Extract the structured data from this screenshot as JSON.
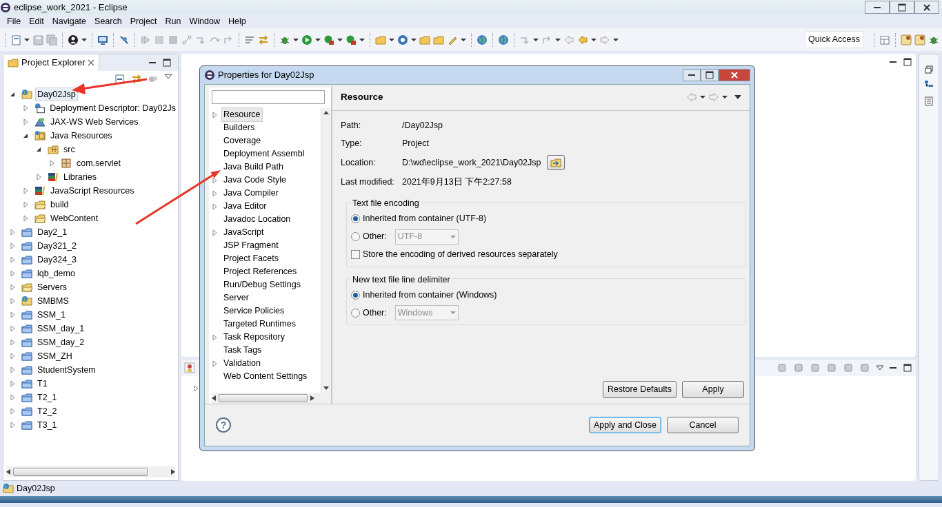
{
  "window": {
    "title": "eclipse_work_2021 - Eclipse"
  },
  "menu": [
    "File",
    "Edit",
    "Navigate",
    "Search",
    "Project",
    "Run",
    "Window",
    "Help"
  ],
  "toolbar": {
    "quick_access": "Quick Access"
  },
  "project_explorer": {
    "title": "Project Explorer",
    "tree": [
      {
        "label": "Day02Jsp",
        "kind": "web-project",
        "expanded": true,
        "selected": true,
        "children": [
          {
            "label": "Deployment Descriptor: Day02Js",
            "kind": "descriptor",
            "expanded": false,
            "selected": false
          },
          {
            "label": "JAX-WS Web Services",
            "kind": "webservices",
            "expanded": false,
            "selected": false
          },
          {
            "label": "Java Resources",
            "kind": "java-resources",
            "expanded": true,
            "selected": false,
            "children": [
              {
                "label": "src",
                "kind": "source-folder",
                "expanded": true,
                "selected": false,
                "children": [
                  {
                    "label": "com.servlet",
                    "kind": "package",
                    "expanded": false,
                    "selected": false
                  }
                ]
              },
              {
                "label": "Libraries",
                "kind": "library",
                "expanded": false,
                "selected": false
              }
            ]
          },
          {
            "label": "JavaScript Resources",
            "kind": "library",
            "expanded": false,
            "selected": false
          },
          {
            "label": "build",
            "kind": "folder",
            "expanded": false,
            "selected": false
          },
          {
            "label": "WebContent",
            "kind": "folder",
            "expanded": false,
            "selected": false
          }
        ]
      },
      {
        "label": "Day2_1",
        "kind": "project",
        "expanded": false,
        "selected": false
      },
      {
        "label": "Day321_2",
        "kind": "project",
        "expanded": false,
        "selected": false
      },
      {
        "label": "Day324_3",
        "kind": "project",
        "expanded": false,
        "selected": false
      },
      {
        "label": "lqb_demo",
        "kind": "project",
        "expanded": false,
        "selected": false
      },
      {
        "label": "Servers",
        "kind": "folder",
        "expanded": false,
        "selected": false
      },
      {
        "label": "SMBMS",
        "kind": "web-project",
        "expanded": false,
        "selected": false
      },
      {
        "label": "SSM_1",
        "kind": "project",
        "expanded": false,
        "selected": false
      },
      {
        "label": "SSM_day_1",
        "kind": "project",
        "expanded": false,
        "selected": false
      },
      {
        "label": "SSM_day_2",
        "kind": "project",
        "expanded": false,
        "selected": false
      },
      {
        "label": "SSM_ZH",
        "kind": "project",
        "expanded": false,
        "selected": false
      },
      {
        "label": "StudentSystem",
        "kind": "project",
        "expanded": false,
        "selected": false
      },
      {
        "label": "T1",
        "kind": "project",
        "expanded": false,
        "selected": false
      },
      {
        "label": "T2_1",
        "kind": "project",
        "expanded": false,
        "selected": false
      },
      {
        "label": "T2_2",
        "kind": "project",
        "expanded": false,
        "selected": false
      },
      {
        "label": "T3_1",
        "kind": "project",
        "expanded": false,
        "selected": false
      }
    ]
  },
  "status_bar": {
    "text": "Day02Jsp"
  },
  "dialog": {
    "title": "Properties for Day02Jsp",
    "nav": [
      {
        "label": "Resource",
        "expandable": true,
        "selected": true
      },
      {
        "label": "Builders",
        "expandable": false,
        "selected": false
      },
      {
        "label": "Coverage",
        "expandable": false,
        "selected": false
      },
      {
        "label": "Deployment Assembl",
        "expandable": false,
        "selected": false
      },
      {
        "label": "Java Build Path",
        "expandable": false,
        "selected": false
      },
      {
        "label": "Java Code Style",
        "expandable": true,
        "selected": false
      },
      {
        "label": "Java Compiler",
        "expandable": true,
        "selected": false
      },
      {
        "label": "Java Editor",
        "expandable": true,
        "selected": false
      },
      {
        "label": "Javadoc Location",
        "expandable": false,
        "selected": false
      },
      {
        "label": "JavaScript",
        "expandable": true,
        "selected": false
      },
      {
        "label": "JSP Fragment",
        "expandable": false,
        "selected": false
      },
      {
        "label": "Project Facets",
        "expandable": false,
        "selected": false
      },
      {
        "label": "Project References",
        "expandable": false,
        "selected": false
      },
      {
        "label": "Run/Debug Settings",
        "expandable": false,
        "selected": false
      },
      {
        "label": "Server",
        "expandable": false,
        "selected": false
      },
      {
        "label": "Service Policies",
        "expandable": false,
        "selected": false
      },
      {
        "label": "Targeted Runtimes",
        "expandable": false,
        "selected": false
      },
      {
        "label": "Task Repository",
        "expandable": true,
        "selected": false
      },
      {
        "label": "Task Tags",
        "expandable": false,
        "selected": false
      },
      {
        "label": "Validation",
        "expandable": true,
        "selected": false
      },
      {
        "label": "Web Content Settings",
        "expandable": false,
        "selected": false
      }
    ],
    "page": {
      "title": "Resource",
      "fields": [
        {
          "label": "Path:",
          "value": "/Day02Jsp",
          "browse_button": false
        },
        {
          "label": "Type:",
          "value": "Project",
          "browse_button": false
        },
        {
          "label": "Location:",
          "value": "D:\\wd\\eclipse_work_2021\\Day02Jsp",
          "browse_button": true
        },
        {
          "label": "Last modified:",
          "value": "2021年9月13日 下午2:27:58",
          "browse_button": false
        }
      ],
      "groups": [
        {
          "title": "Text file encoding",
          "options": [
            {
              "kind": "radio",
              "label": "Inherited from container (UTF-8)",
              "selected": true
            },
            {
              "kind": "radio-select",
              "label": "Other:",
              "selected": false,
              "select": {
                "value": "UTF-8",
                "disabled": true
              }
            },
            {
              "kind": "checkbox",
              "label": "Store the encoding of derived resources separately",
              "checked": false
            }
          ]
        },
        {
          "title": "New text file line delimiter",
          "options": [
            {
              "kind": "radio",
              "label": "Inherited from container (Windows)",
              "selected": true
            },
            {
              "kind": "radio-select",
              "label": "Other:",
              "selected": false,
              "select": {
                "value": "Windows",
                "disabled": true
              }
            }
          ]
        }
      ],
      "buttons": [
        "Restore Defaults",
        "Apply"
      ]
    },
    "help": "?",
    "footer_buttons": [
      {
        "label": "Apply and Close",
        "default": true
      },
      {
        "label": "Cancel",
        "default": false
      }
    ]
  }
}
